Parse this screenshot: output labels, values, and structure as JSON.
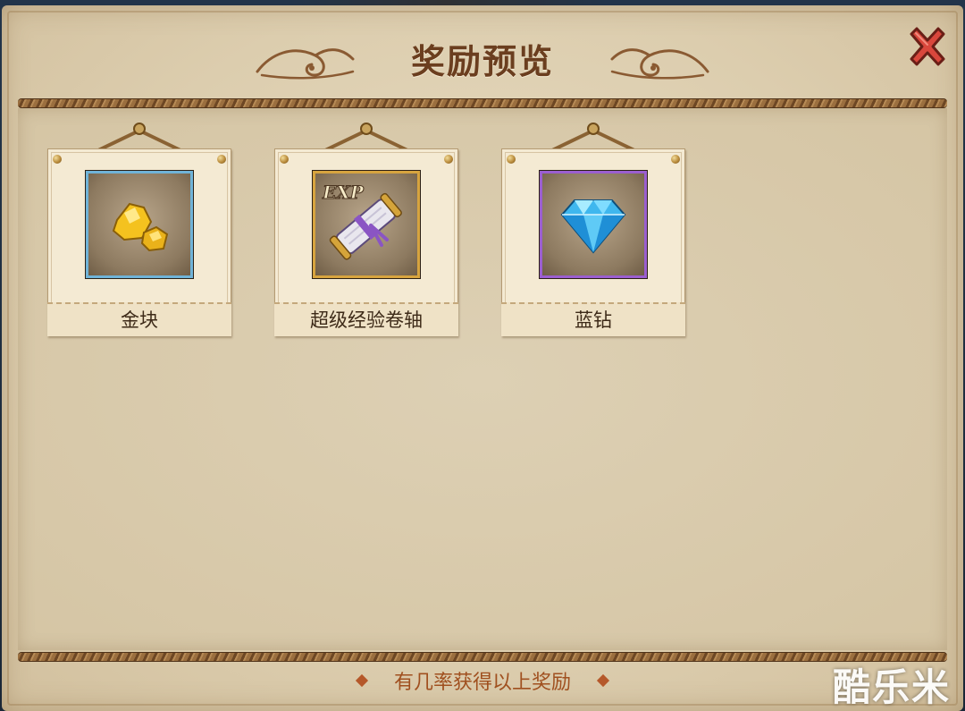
{
  "dialog": {
    "title": "奖励预览",
    "close_icon": "close-x-icon",
    "footer_note": "有几率获得以上奖励"
  },
  "rewards": [
    {
      "label": "金块",
      "icon": "gold-nugget-icon",
      "frame_color": "#6fb3d8"
    },
    {
      "label": "超级经验卷轴",
      "icon": "exp-scroll-icon",
      "icon_text": "EXP",
      "frame_color": "#d7a43f"
    },
    {
      "label": "蓝钻",
      "icon": "blue-diamond-icon",
      "frame_color": "#9b5ed0"
    }
  ],
  "watermark": "酷乐米",
  "colors": {
    "parchment": "#e8dcc2",
    "title": "#6b3e1f",
    "footer_text": "#a0501f",
    "close": "#d9473c"
  }
}
